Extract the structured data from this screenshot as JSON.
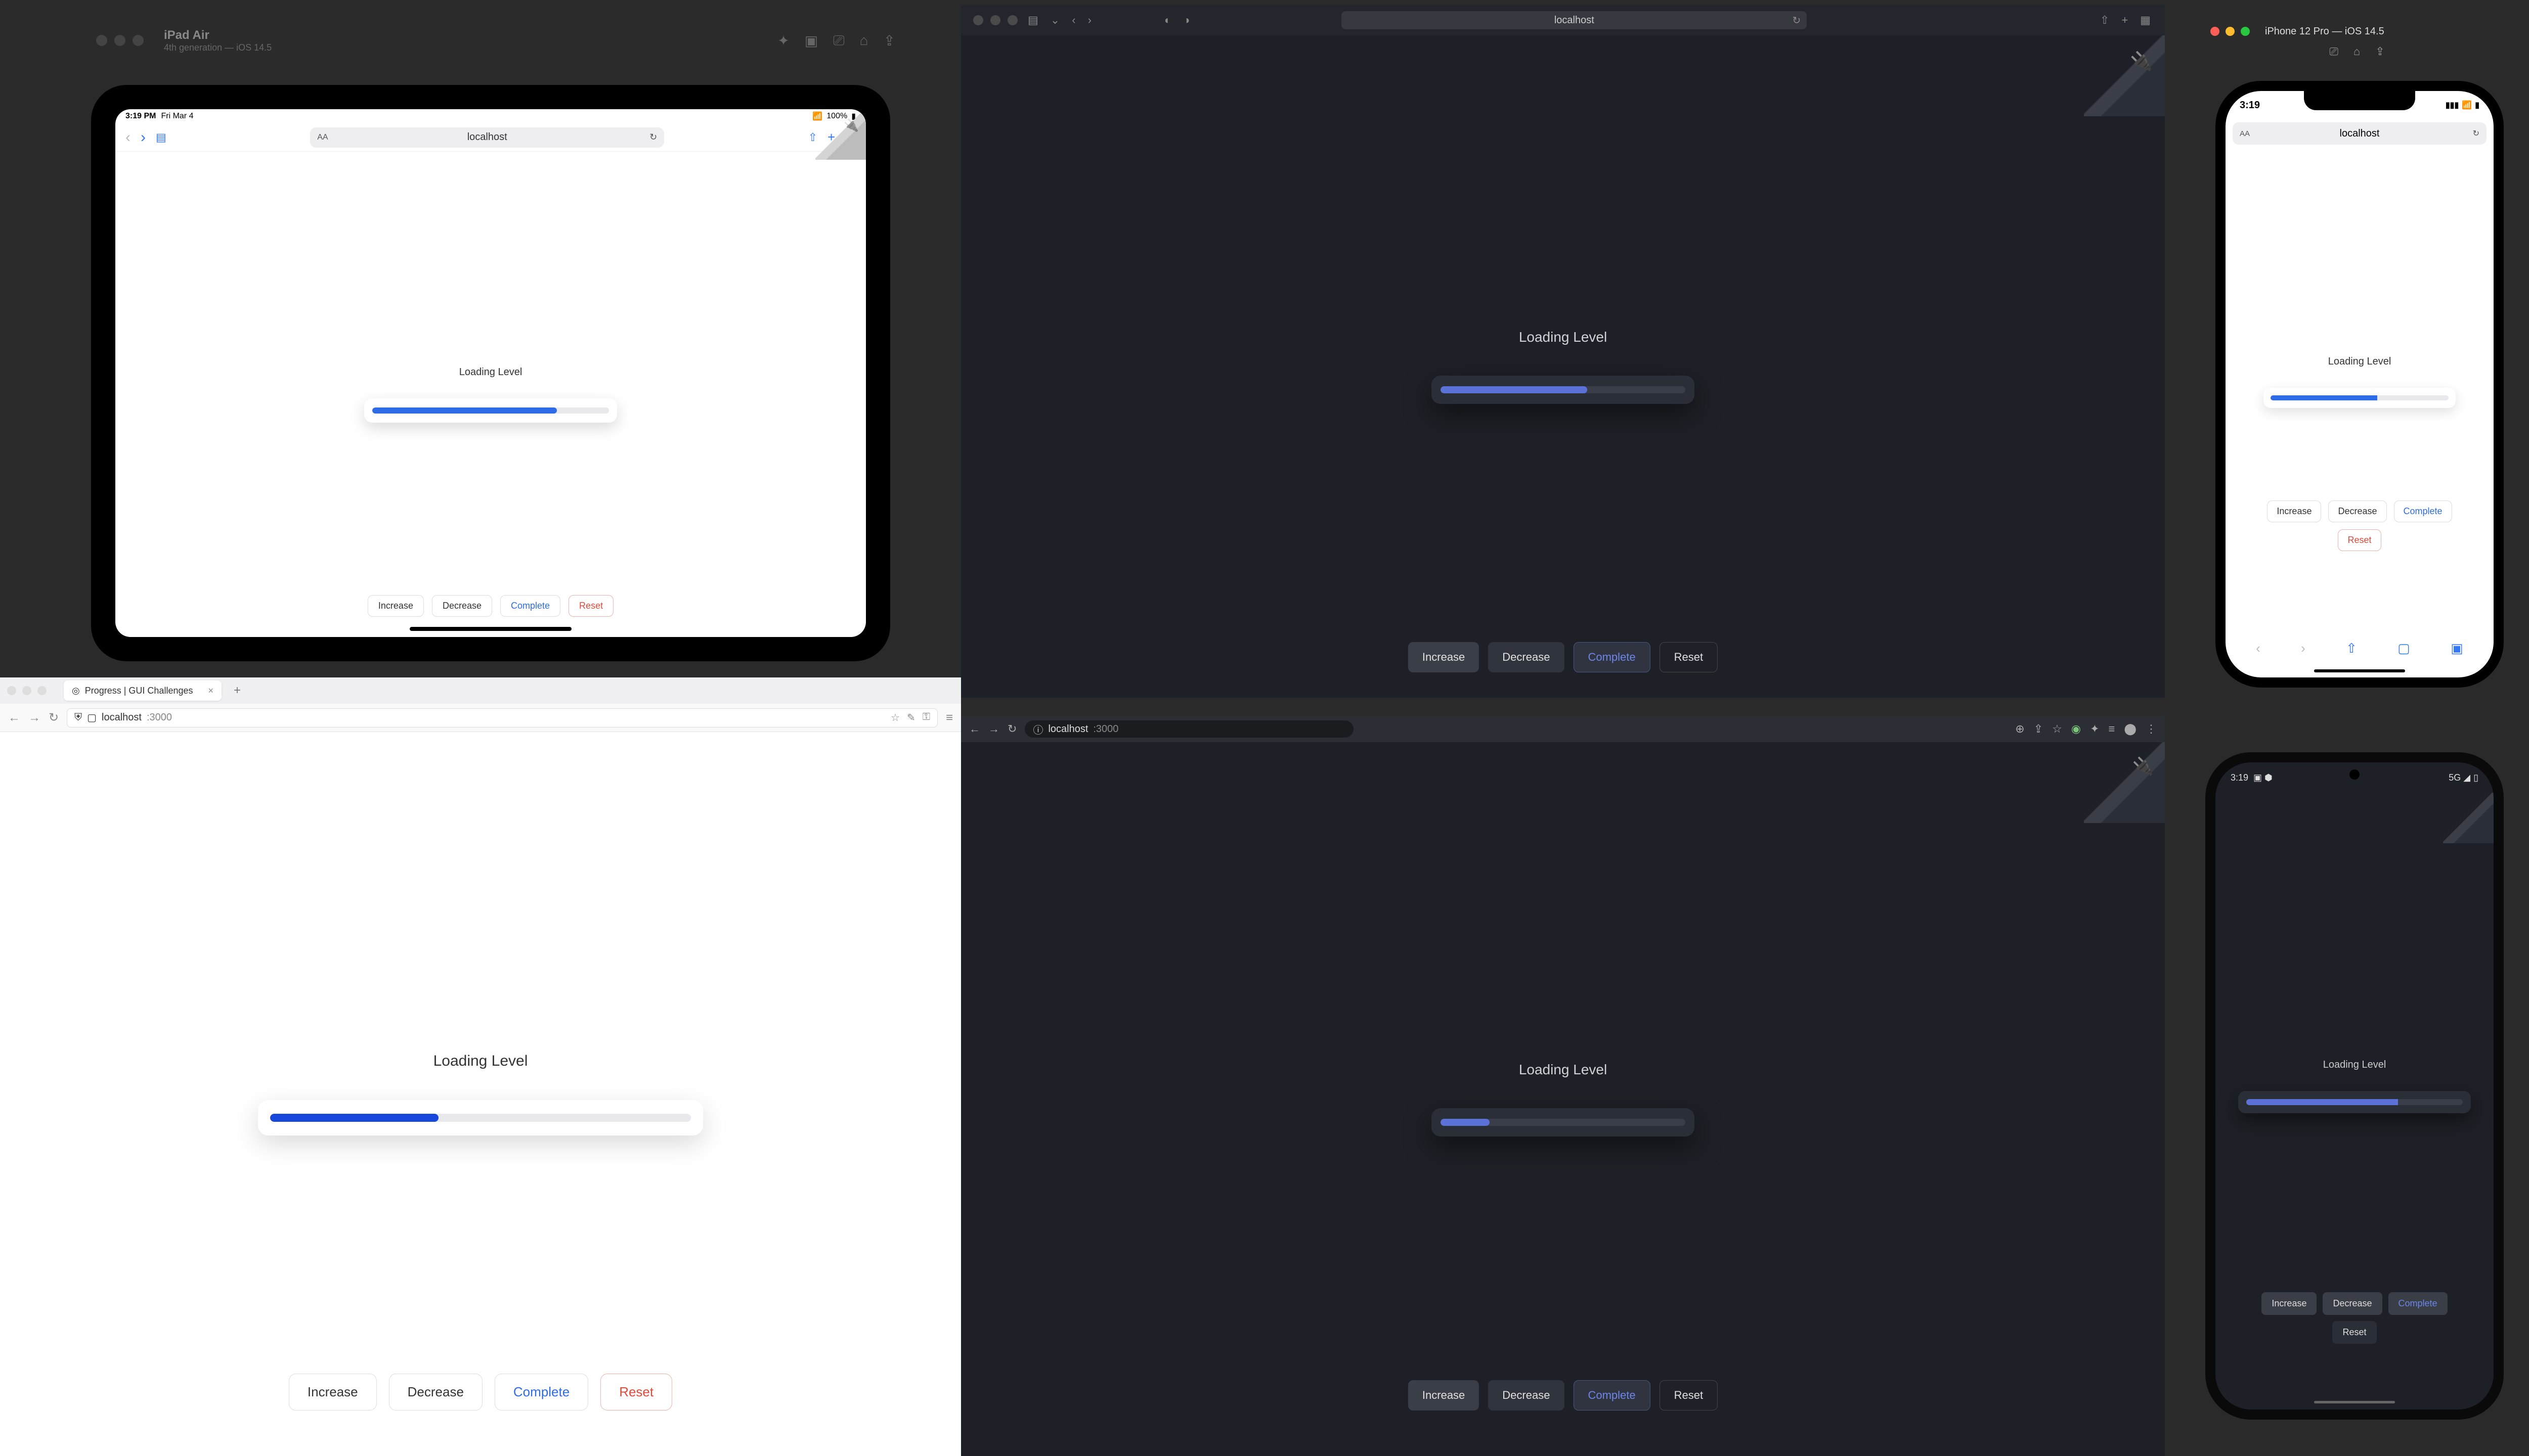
{
  "common": {
    "loading_label": "Loading Level",
    "buttons": {
      "increase": "Increase",
      "decrease": "Decrease",
      "complete": "Complete",
      "reset": "Reset"
    },
    "address_host": "localhost",
    "address_port": ":3000"
  },
  "ipad_sim": {
    "title": "iPad Air",
    "subtitle": "4th generation — iOS 14.5",
    "statusbar_time": "3:19 PM",
    "statusbar_date": "Fri Mar 4",
    "battery": "100%",
    "progress_percent": 78
  },
  "safari": {
    "progress_percent": 60
  },
  "iphone_sim": {
    "title": "iPhone 12 Pro — iOS 14.5",
    "statusbar_time": "3:19",
    "progress_percent": 60
  },
  "firefox": {
    "tab_title": "Progress | GUI Challenges",
    "progress_percent": 40
  },
  "chrome": {
    "progress_percent": 20
  },
  "android": {
    "statusbar_time": "3:19",
    "progress_percent": 70
  }
}
